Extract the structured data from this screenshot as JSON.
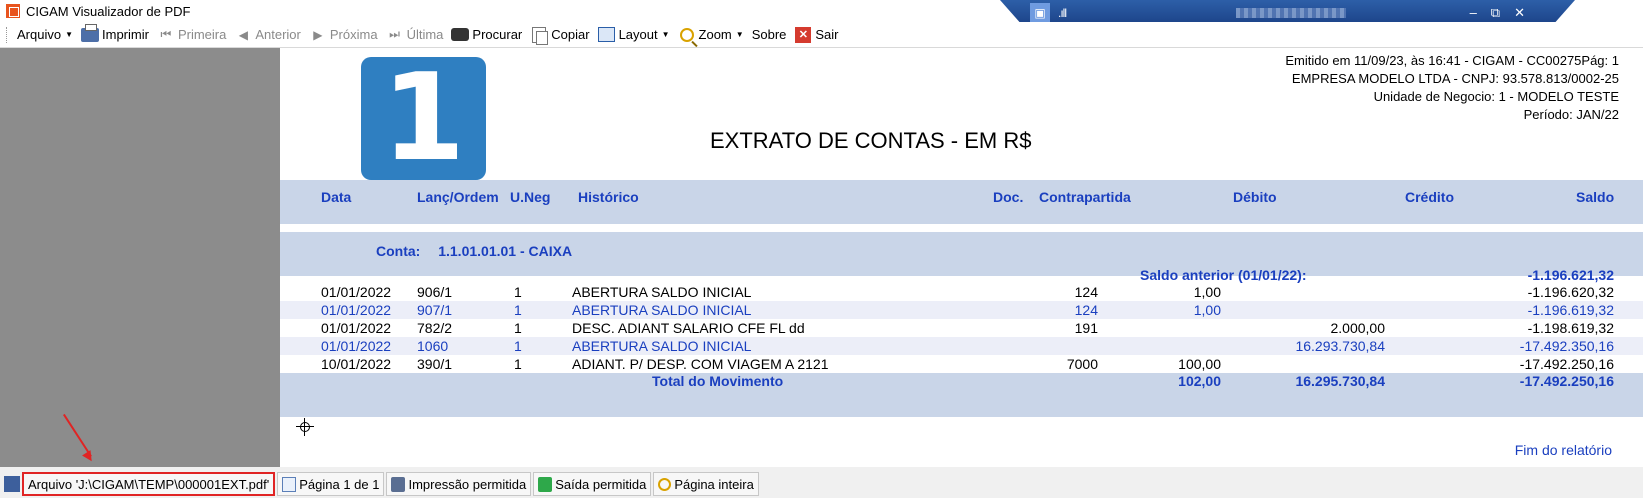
{
  "window": {
    "title": "CIGAM Visualizador de PDF",
    "remote_controls": {
      "minimize": "–",
      "restore": "⧉",
      "close": "✕"
    }
  },
  "toolbar": {
    "arquivo": "Arquivo",
    "imprimir": "Imprimir",
    "primeira": "Primeira",
    "anterior": "Anterior",
    "proxima": "Próxima",
    "ultima": "Última",
    "procurar": "Procurar",
    "copiar": "Copiar",
    "layout": "Layout",
    "zoom": "Zoom",
    "sobre": "Sobre",
    "sair": "Sair"
  },
  "report": {
    "logo_digit": "1",
    "header_lines": [
      "Emitido em 11/09/23, às 16:41 - CIGAM - CC00275Pág: 1",
      "EMPRESA MODELO LTDA - CNPJ: 93.578.813/0002-25",
      "Unidade de Negocio: 1   - MODELO TESTE",
      "Período: JAN/22"
    ],
    "title": "EXTRATO DE CONTAS - EM R$",
    "columns": {
      "data": "Data",
      "lanc": "Lanç/Ordem",
      "uneg": "U.Neg",
      "hist": "Histórico",
      "doc": "Doc.",
      "contra": "Contrapartida",
      "deb": "Débito",
      "cred": "Crédito",
      "saldo": "Saldo"
    },
    "conta_label": "Conta:",
    "conta_value": "1.1.01.01.01 - CAIXA",
    "saldo_anterior_label": "Saldo anterior (01/01/22):",
    "saldo_anterior_value": "-1.196.621,32",
    "rows": [
      {
        "data": "01/01/2022",
        "lanc": "906/1",
        "uneg": "1",
        "hist": "ABERTURA SALDO INICIAL",
        "contra": "124",
        "deb": "1,00",
        "cred": "",
        "saldo": "-1.196.620,32"
      },
      {
        "data": "01/01/2022",
        "lanc": "907/1",
        "uneg": "1",
        "hist": "ABERTURA SALDO INICIAL",
        "contra": "124",
        "deb": "1,00",
        "cred": "",
        "saldo": "-1.196.619,32"
      },
      {
        "data": "01/01/2022",
        "lanc": "782/2",
        "uneg": "1",
        "hist": "DESC. ADIANT SALARIO CFE FL dd",
        "contra": "191",
        "deb": "",
        "cred": "2.000,00",
        "saldo": "-1.198.619,32"
      },
      {
        "data": "01/01/2022",
        "lanc": "1060",
        "uneg": "1",
        "hist": "ABERTURA SALDO INICIAL",
        "contra": "",
        "deb": "",
        "cred": "16.293.730,84",
        "saldo": "-17.492.350,16"
      },
      {
        "data": "10/01/2022",
        "lanc": "390/1",
        "uneg": "1",
        "hist": "ADIANT. P/ DESP. COM VIAGEM A 2121",
        "contra": "7000",
        "deb": "100,00",
        "cred": "",
        "saldo": "-17.492.250,16"
      }
    ],
    "total_label": "Total do Movimento",
    "total_deb": "102,00",
    "total_cred": "16.295.730,84",
    "total_saldo": "-17.492.250,16",
    "fim": "Fim do relatório"
  },
  "statusbar": {
    "arquivo": "Arquivo 'J:\\CIGAM\\TEMP\\000001EXT.pdf'",
    "pagina": "Página 1 de 1",
    "impressao": "Impressão permitida",
    "saida": "Saída permitida",
    "pagina_inteira": "Página inteira"
  },
  "colors": {
    "accent_blue": "#1a3fbf",
    "band": "#c9d5e8",
    "highlight_red": "#e02424",
    "logo_blue": "#2f7fc1"
  }
}
